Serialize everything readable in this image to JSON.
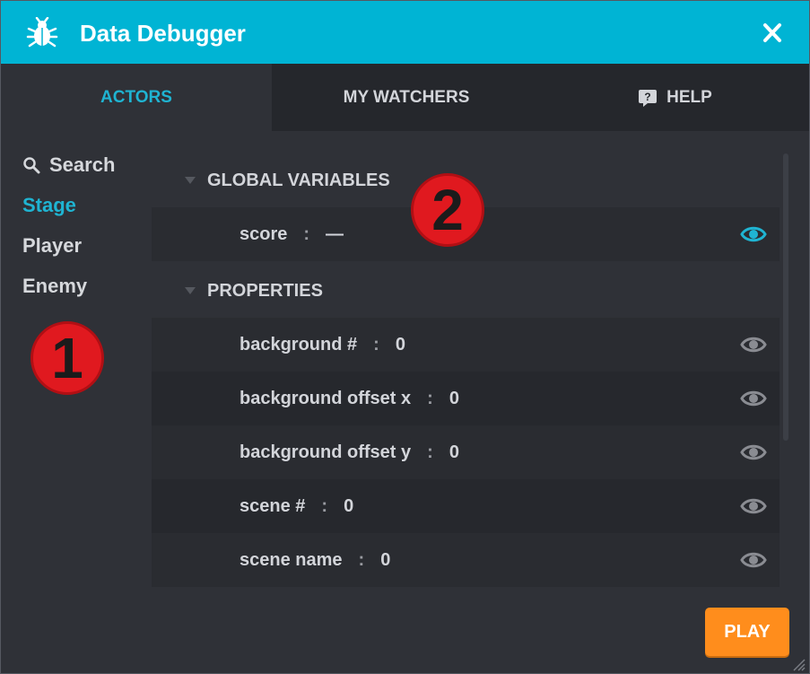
{
  "window": {
    "title": "Data Debugger"
  },
  "tabs": [
    {
      "label": "ACTORS",
      "active": true
    },
    {
      "label": "MY WATCHERS",
      "active": false
    },
    {
      "label": "HELP",
      "active": false,
      "icon": "help-icon"
    }
  ],
  "sidebar": {
    "search_label": "Search",
    "items": [
      {
        "label": "Stage",
        "active": true
      },
      {
        "label": "Player",
        "active": false
      },
      {
        "label": "Enemy",
        "active": false
      }
    ]
  },
  "sections": {
    "global": {
      "title": "GLOBAL VARIABLES",
      "rows": [
        {
          "name": "score",
          "value": "—",
          "watched": true
        }
      ]
    },
    "properties": {
      "title": "PROPERTIES",
      "rows": [
        {
          "name": "background #",
          "value": "0",
          "watched": false
        },
        {
          "name": "background offset x",
          "value": "0",
          "watched": false
        },
        {
          "name": "background offset y",
          "value": "0",
          "watched": false
        },
        {
          "name": "scene #",
          "value": "0",
          "watched": false
        },
        {
          "name": "scene name",
          "value": "0",
          "watched": false
        }
      ]
    }
  },
  "separator": ":",
  "play_button": "PLAY",
  "annotations": [
    "1",
    "2"
  ],
  "colors": {
    "titlebar": "#00b4d4",
    "accent": "#1fb4d2",
    "play": "#ff8d1c",
    "badge": "#e0191f"
  }
}
